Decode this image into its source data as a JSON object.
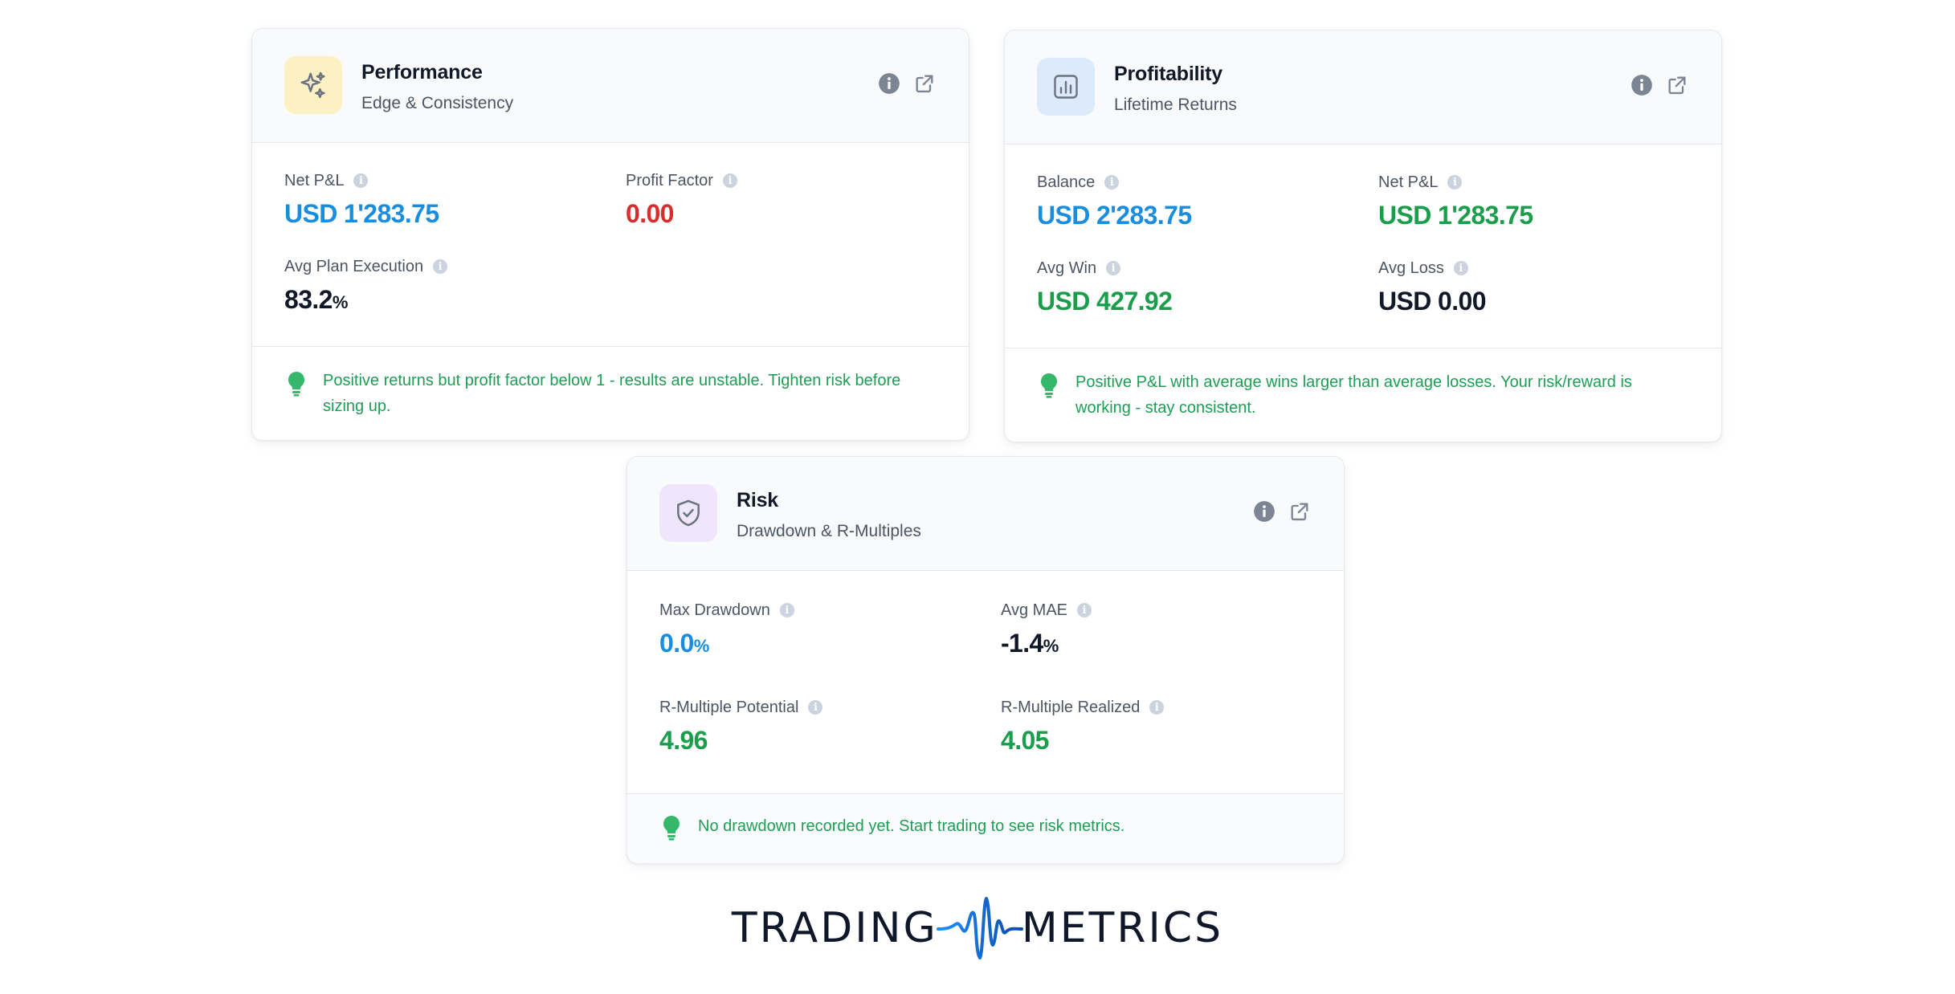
{
  "cards": {
    "performance": {
      "title": "Performance",
      "subtitle": "Edge & Consistency",
      "icon": "sparkles-icon",
      "icon_bg": "#fdf1c4",
      "metrics": [
        {
          "label": "Net P&L",
          "value": "USD 1'283.75",
          "unit": "",
          "color": "#1a8ddf"
        },
        {
          "label": "Profit Factor",
          "value": "0.00",
          "unit": "",
          "color": "#d92d2d"
        },
        {
          "label": "Avg Plan Execution",
          "value": "83.2",
          "unit": "%",
          "color": "#111827"
        }
      ],
      "tip": "Positive returns but profit factor below 1 - results are unstable. Tighten risk before sizing up."
    },
    "profitability": {
      "title": "Profitability",
      "subtitle": "Lifetime Returns",
      "icon": "bar-chart-icon",
      "icon_bg": "#dceafc",
      "metrics": [
        {
          "label": "Balance",
          "value": "USD 2'283.75",
          "unit": "",
          "color": "#1a8ddf"
        },
        {
          "label": "Net P&L",
          "value": "USD 1'283.75",
          "unit": "",
          "color": "#1b9e4b"
        },
        {
          "label": "Avg Win",
          "value": "USD 427.92",
          "unit": "",
          "color": "#1b9e4b"
        },
        {
          "label": "Avg Loss",
          "value": "USD 0.00",
          "unit": "",
          "color": "#111827"
        }
      ],
      "tip": "Positive P&L with average wins larger than average losses. Your risk/reward is working - stay consistent."
    },
    "risk": {
      "title": "Risk",
      "subtitle": "Drawdown & R-Multiples",
      "icon": "shield-check-icon",
      "icon_bg": "#efe6fb",
      "metrics": [
        {
          "label": "Max Drawdown",
          "value": "0.0",
          "unit": "%",
          "color": "#1a8ddf"
        },
        {
          "label": "Avg MAE",
          "value": "-1.4",
          "unit": "%",
          "color": "#111827"
        },
        {
          "label": "R-Multiple Potential",
          "value": "4.96",
          "unit": "",
          "color": "#1b9e4b"
        },
        {
          "label": "R-Multiple Realized",
          "value": "4.05",
          "unit": "",
          "color": "#1b9e4b"
        }
      ],
      "tip": "No drawdown recorded yet. Start trading to see risk metrics."
    }
  },
  "logo": {
    "left": "TRADING",
    "right": "METRICS"
  },
  "colors": {
    "tip_green": "#1f9d55",
    "bulb_green": "#35b86a",
    "icon_gray": "#6b7280"
  }
}
